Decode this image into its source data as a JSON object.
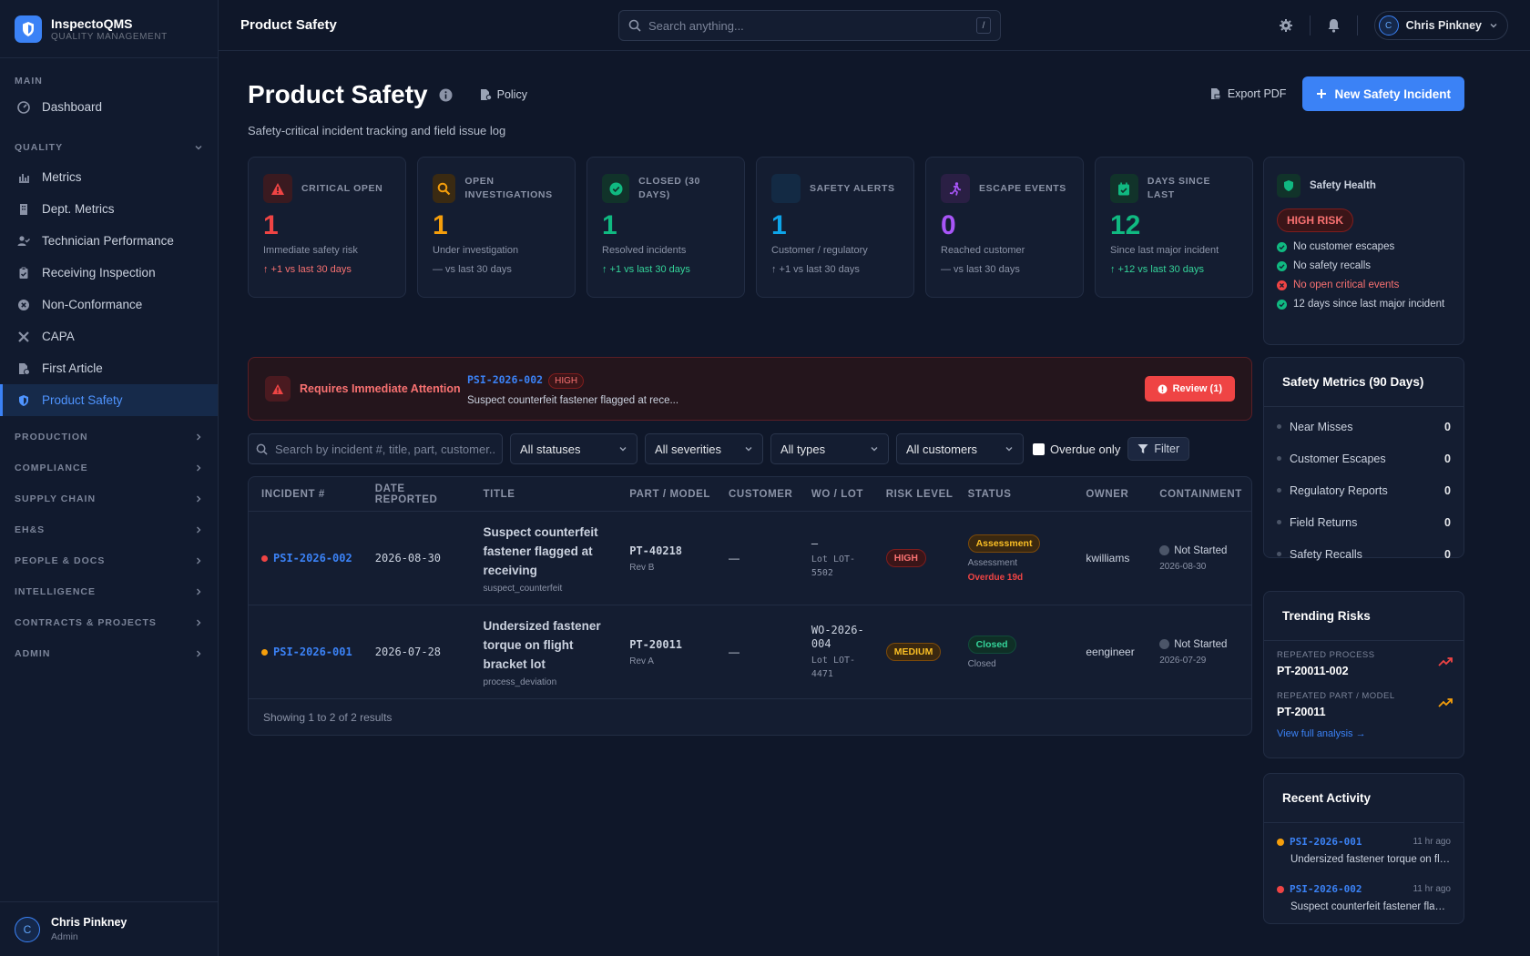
{
  "brand": {
    "name": "InspectoQMS",
    "subtitle": "QUALITY MANAGEMENT"
  },
  "sidebar": {
    "main_section": "MAIN",
    "dashboard": "Dashboard",
    "quality_section": "QUALITY",
    "quality_items": [
      "Metrics",
      "Dept. Metrics",
      "Technician Performance",
      "Receiving Inspection",
      "Non-Conformance",
      "CAPA",
      "First Article",
      "Product Safety"
    ],
    "groups": [
      "PRODUCTION",
      "COMPLIANCE",
      "SUPPLY CHAIN",
      "EH&S",
      "PEOPLE & DOCS",
      "INTELLIGENCE",
      "CONTRACTS & PROJECTS",
      "ADMIN"
    ],
    "user": {
      "initial": "C",
      "name": "Chris Pinkney",
      "role": "Admin"
    }
  },
  "topbar": {
    "title": "Product Safety",
    "search_placeholder": "Search anything...",
    "search_shortcut": "/",
    "user": {
      "initial": "C",
      "name": "Chris Pinkney"
    }
  },
  "page": {
    "title": "Product Safety",
    "policy": "Policy",
    "subtitle": "Safety-critical incident tracking and field issue log",
    "export": "Export PDF",
    "new_incident": "New Safety Incident"
  },
  "stats": [
    {
      "label": "CRITICAL OPEN",
      "value": "1",
      "desc": "Immediate safety risk",
      "trend": "↑ +1 vs last 30 days",
      "color": "#ef4444",
      "trend_color": "#f87171",
      "bg": "#3a1a20"
    },
    {
      "label": "OPEN INVESTIGATIONS",
      "value": "1",
      "desc": "Under investigation",
      "trend": "— vs last 30 days",
      "color": "#f59e0b",
      "trend_color": "#8b93a7",
      "bg": "#3a2a12"
    },
    {
      "label": "CLOSED (30 DAYS)",
      "value": "1",
      "desc": "Resolved incidents",
      "trend": "↑ +1 vs last 30 days",
      "color": "#10b981",
      "trend_color": "#34d399",
      "bg": "#11332a"
    },
    {
      "label": "SAFETY ALERTS",
      "value": "1",
      "desc": "Customer / regulatory",
      "trend": "↑ +1 vs last 30 days",
      "color": "#0ea5e9",
      "trend_color": "#8b93a7",
      "bg": "#132a44"
    },
    {
      "label": "ESCAPE EVENTS",
      "value": "0",
      "desc": "Reached customer",
      "trend": "— vs last 30 days",
      "color": "#a855f7",
      "trend_color": "#8b93a7",
      "bg": "#2a1f44"
    },
    {
      "label": "DAYS SINCE LAST",
      "value": "12",
      "desc": "Since last major incident",
      "trend": "↑ +12 vs last 30 days",
      "color": "#10b981",
      "trend_color": "#34d399",
      "bg": "#11332a"
    }
  ],
  "health": {
    "title": "Safety Health",
    "risk": "HIGH RISK",
    "items": [
      {
        "text": "No customer escapes",
        "ok": true
      },
      {
        "text": "No safety recalls",
        "ok": true
      },
      {
        "text": "No open critical events",
        "ok": false
      },
      {
        "text": "12 days since last major incident",
        "ok": true
      }
    ]
  },
  "attention": {
    "title": "Requires Immediate Attention",
    "incident_id": "PSI-2026-002",
    "severity": "HIGH",
    "summary": "Suspect counterfeit fastener flagged at rece...",
    "review": "Review (1)"
  },
  "filters": {
    "search_placeholder": "Search by incident #, title, part, customer...",
    "status": "All statuses",
    "severity": "All severities",
    "type": "All types",
    "customer": "All customers",
    "overdue": "Overdue only",
    "filter": "Filter"
  },
  "table": {
    "headers": [
      "INCIDENT #",
      "DATE REPORTED",
      "TITLE",
      "PART / MODEL",
      "CUSTOMER",
      "WO / LOT",
      "RISK LEVEL",
      "STATUS",
      "OWNER",
      "CONTAINMENT"
    ],
    "rows": [
      {
        "id": "PSI-2026-002",
        "dot": "#ef4444",
        "date": "2026-08-30",
        "title": "Suspect counterfeit fastener flagged at receiving",
        "type": "suspect_counterfeit",
        "part": "PT-40218",
        "rev": "Rev B",
        "customer": "—",
        "wo": "—",
        "lot": "Lot LOT-5502",
        "risk": "HIGH",
        "status": "Assessment",
        "status_sub": "Assessment",
        "overdue": "Overdue 19d",
        "owner": "kwilliams",
        "containment": "Not Started",
        "containment_date": "2026-08-30"
      },
      {
        "id": "PSI-2026-001",
        "dot": "#f59e0b",
        "date": "2026-07-28",
        "title": "Undersized fastener torque on flight bracket lot",
        "type": "process_deviation",
        "part": "PT-20011",
        "rev": "Rev A",
        "customer": "—",
        "wo": "WO-2026-004",
        "lot": "Lot LOT-4471",
        "risk": "MEDIUM",
        "status": "Closed",
        "status_sub": "Closed",
        "overdue": "",
        "owner": "eengineer",
        "containment": "Not Started",
        "containment_date": "2026-07-29"
      }
    ],
    "footer": "Showing 1 to 2 of 2 results"
  },
  "metrics": {
    "title": "Safety Metrics (90 Days)",
    "items": [
      {
        "label": "Near Misses",
        "value": "0"
      },
      {
        "label": "Customer Escapes",
        "value": "0"
      },
      {
        "label": "Regulatory Reports",
        "value": "0"
      },
      {
        "label": "Field Returns",
        "value": "0"
      },
      {
        "label": "Safety Recalls",
        "value": "0"
      }
    ]
  },
  "trending": {
    "title": "Trending Risks",
    "items": [
      {
        "label": "REPEATED PROCESS",
        "value": "PT-20011-002",
        "color": "#ef4444"
      },
      {
        "label": "REPEATED PART / MODEL",
        "value": "PT-20011",
        "color": "#f59e0b"
      }
    ],
    "link": "View full analysis →"
  },
  "activity": {
    "title": "Recent Activity",
    "items": [
      {
        "id": "PSI-2026-001",
        "time": "11 hr ago",
        "text": "Undersized fastener torque on flig...",
        "color": "#f59e0b"
      },
      {
        "id": "PSI-2026-002",
        "time": "11 hr ago",
        "text": "Suspect counterfeit fastener flagg...",
        "color": "#ef4444"
      }
    ]
  }
}
